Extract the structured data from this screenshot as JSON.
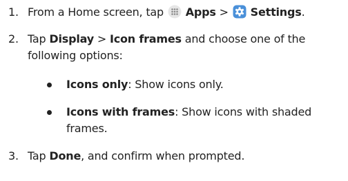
{
  "steps": [
    {
      "number": "1.",
      "parts": {
        "p0": "From a Home screen, tap",
        "apps": "Apps",
        "sep": ">",
        "settings": "Settings",
        "end": "."
      }
    },
    {
      "number": "2.",
      "parts": {
        "p0": "Tap",
        "display": "Display",
        "sep": ">",
        "icon_frames": "Icon frames",
        "rest": "and choose one of the following options:"
      },
      "options": [
        {
          "term": "Icons only",
          "desc": ": Show icons only."
        },
        {
          "term": "Icons with frames",
          "desc": ": Show icons with shaded frames."
        }
      ]
    },
    {
      "number": "3.",
      "parts": {
        "p0": "Tap",
        "done": "Done",
        "rest": ", and confirm when prompted."
      }
    }
  ],
  "icons": {
    "apps": {
      "name": "apps-grid-icon",
      "bg": "#e6e6e6",
      "dots": "#8a8a8a"
    },
    "settings": {
      "name": "settings-gear-icon",
      "bg": "#4a90d9",
      "fg": "#ffffff"
    }
  }
}
